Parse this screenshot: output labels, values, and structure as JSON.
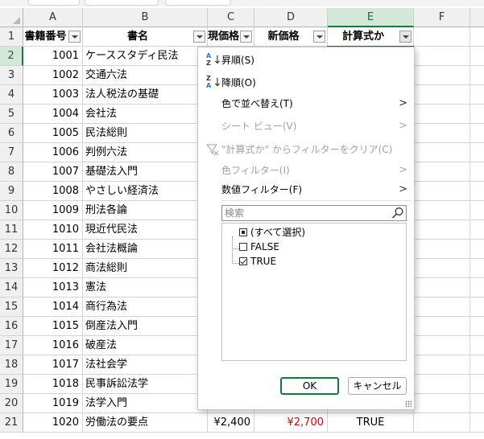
{
  "columns": [
    "A",
    "B",
    "C",
    "D",
    "E",
    "F"
  ],
  "header_row": {
    "row_number": "1",
    "cells": [
      "書籍番号",
      "書名",
      "現価格",
      "新価格",
      "計算式か"
    ]
  },
  "rows": [
    {
      "num": "2",
      "id": "1001",
      "title": "ケーススタディ民法",
      "price": "",
      "new_price": "",
      "calc": ""
    },
    {
      "num": "3",
      "id": "1002",
      "title": "交通六法",
      "price": "",
      "new_price": "",
      "calc": ""
    },
    {
      "num": "4",
      "id": "1003",
      "title": "法人税法の基礎",
      "price": "",
      "new_price": "",
      "calc": ""
    },
    {
      "num": "5",
      "id": "1004",
      "title": "会社法",
      "price": "",
      "new_price": "",
      "calc": ""
    },
    {
      "num": "6",
      "id": "1005",
      "title": "民法総則",
      "price": "",
      "new_price": "",
      "calc": ""
    },
    {
      "num": "7",
      "id": "1006",
      "title": "判例六法",
      "price": "",
      "new_price": "",
      "calc": ""
    },
    {
      "num": "8",
      "id": "1007",
      "title": "基礎法入門",
      "price": "",
      "new_price": "",
      "calc": ""
    },
    {
      "num": "9",
      "id": "1008",
      "title": "やさしい経済法",
      "price": "",
      "new_price": "",
      "calc": ""
    },
    {
      "num": "10",
      "id": "1009",
      "title": "刑法各論",
      "price": "",
      "new_price": "",
      "calc": ""
    },
    {
      "num": "11",
      "id": "1010",
      "title": "現近代民法",
      "price": "",
      "new_price": "",
      "calc": ""
    },
    {
      "num": "12",
      "id": "1011",
      "title": "会社法概論",
      "price": "",
      "new_price": "",
      "calc": ""
    },
    {
      "num": "13",
      "id": "1012",
      "title": "商法総則",
      "price": "",
      "new_price": "",
      "calc": ""
    },
    {
      "num": "14",
      "id": "1013",
      "title": "憲法",
      "price": "",
      "new_price": "",
      "calc": ""
    },
    {
      "num": "15",
      "id": "1014",
      "title": "商行為法",
      "price": "",
      "new_price": "",
      "calc": ""
    },
    {
      "num": "16",
      "id": "1015",
      "title": "倒産法入門",
      "price": "",
      "new_price": "",
      "calc": ""
    },
    {
      "num": "17",
      "id": "1016",
      "title": "破産法",
      "price": "",
      "new_price": "",
      "calc": ""
    },
    {
      "num": "18",
      "id": "1017",
      "title": "法社会学",
      "price": "",
      "new_price": "",
      "calc": ""
    },
    {
      "num": "19",
      "id": "1018",
      "title": "民事訴訟法学",
      "price": "",
      "new_price": "",
      "calc": ""
    },
    {
      "num": "20",
      "id": "1019",
      "title": "法学入門",
      "price": "",
      "new_price": "",
      "calc": ""
    },
    {
      "num": "21",
      "id": "1020",
      "title": "労働法の要点",
      "price": "¥2,400",
      "new_price": "¥2,700",
      "calc": "TRUE"
    }
  ],
  "filter_menu": {
    "sort_asc": "昇順(S)",
    "sort_desc": "降順(O)",
    "sort_by_color": "色で並べ替え(T)",
    "sheet_view": "シート ビュー(V)",
    "clear_filter": "\"計算式か\" からフィルターをクリア(C)",
    "color_filter": "色フィルター(I)",
    "number_filter": "数値フィルター(F)",
    "search_placeholder": "検索",
    "list_items": [
      {
        "label": "(すべて選択)",
        "state": "partial"
      },
      {
        "label": "FALSE",
        "state": "unchecked"
      },
      {
        "label": "TRUE",
        "state": "checked"
      }
    ],
    "ok_label": "OK",
    "cancel_label": "キャンセル"
  },
  "colors": {
    "accent_green": "#107c41",
    "selected_header_bg": "#d3e8d8",
    "negative_red": "#e00000"
  },
  "icons": {
    "sort_asc": "sort-ascending-icon",
    "sort_desc": "sort-descending-icon",
    "clear_filter": "clear-filter-icon",
    "search": "search-icon",
    "submenu": "chevron-right-icon",
    "column_filter": "filter-dropdown-icon"
  }
}
